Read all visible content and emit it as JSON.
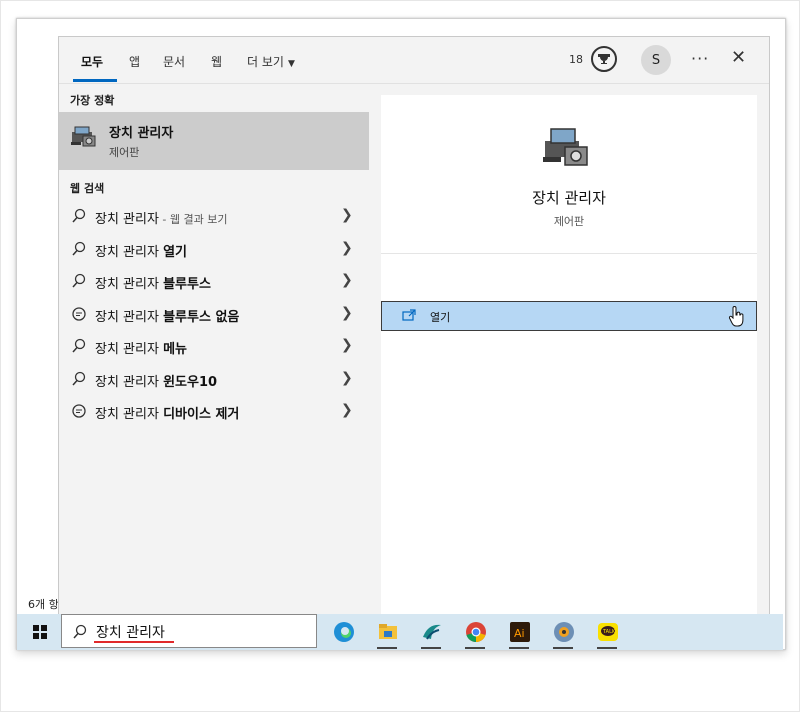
{
  "tabs": [
    {
      "label": "모두",
      "active": true
    },
    {
      "label": "앱"
    },
    {
      "label": "문서"
    },
    {
      "label": "웹"
    },
    {
      "label": "더 보기"
    }
  ],
  "header": {
    "points": "18",
    "avatar_initial": "S",
    "more": "···",
    "close": "✕"
  },
  "best_match": {
    "section": "가장 정확",
    "title": "장치 관리자",
    "subtitle": "제어판",
    "icon": "device-manager-icon"
  },
  "web_search": {
    "section": "웹 검색",
    "items": [
      {
        "prefix": "장치 관리자",
        "bold": "",
        "suffix": " - 웹 결과 보기",
        "icon": "search-icon"
      },
      {
        "prefix": "장치 관리자 ",
        "bold": "열기",
        "suffix": "",
        "icon": "search-icon"
      },
      {
        "prefix": "장치 관리자 ",
        "bold": "블루투스",
        "suffix": "",
        "icon": "search-icon"
      },
      {
        "prefix": "장치 관리자 ",
        "bold": "블루투스 없음",
        "suffix": "",
        "icon": "chat-icon"
      },
      {
        "prefix": "장치 관리자 ",
        "bold": "메뉴",
        "suffix": "",
        "icon": "search-icon"
      },
      {
        "prefix": "장치 관리자 ",
        "bold": "윈도우10",
        "suffix": "",
        "icon": "search-icon"
      },
      {
        "prefix": "장치 관리자 ",
        "bold": "디바이스 제거",
        "suffix": "",
        "icon": "chat-icon"
      }
    ]
  },
  "detail": {
    "title": "장치 관리자",
    "subtitle": "제어판",
    "action_label": "열기"
  },
  "desktop": {
    "partial_text": "6개 항"
  },
  "taskbar": {
    "search_value": "장치 관리자",
    "apps": [
      "edge-icon",
      "file-explorer-icon",
      "app-icon",
      "chrome-icon",
      "illustrator-icon",
      "media-player-icon",
      "kakaotalk-icon"
    ]
  },
  "colors": {
    "accent": "#0067c0",
    "selected_bg": "#cccccc",
    "action_bg": "#b6d7f4",
    "taskbar_bg": "#d6e7f2",
    "underline": "#e0292b"
  }
}
